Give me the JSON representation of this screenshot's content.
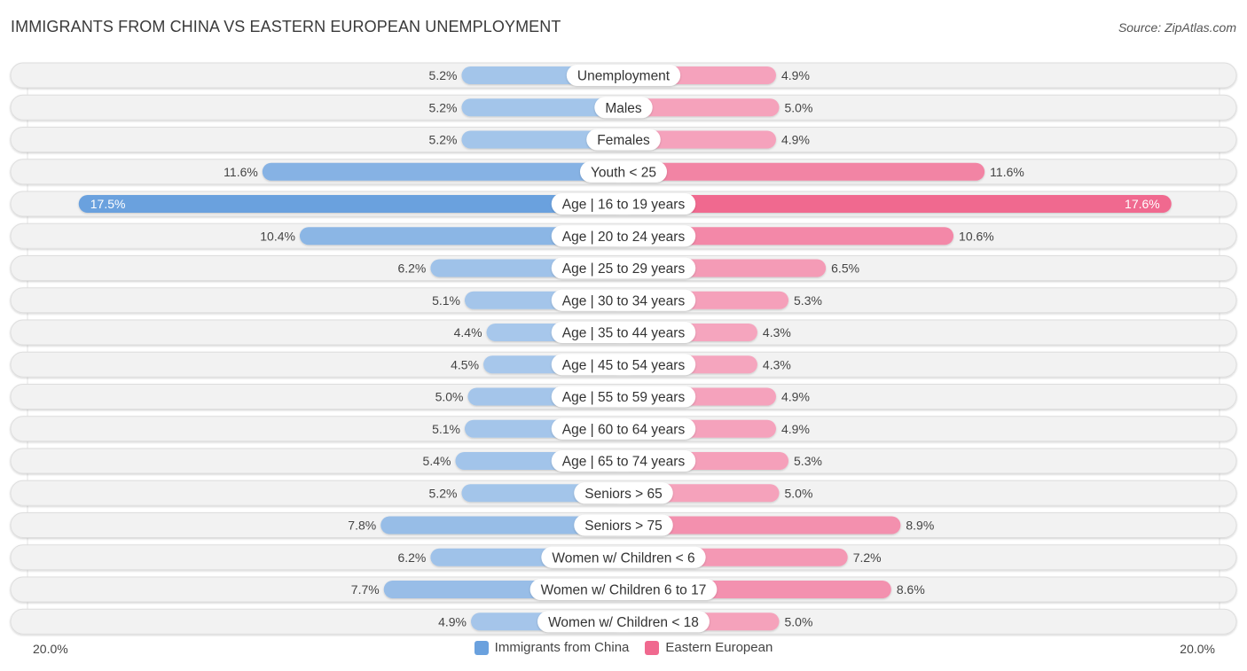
{
  "header": {
    "title": "IMMIGRANTS FROM CHINA VS EASTERN EUROPEAN UNEMPLOYMENT",
    "source": "Source: ZipAtlas.com"
  },
  "colors": {
    "china": "#6aa1de",
    "china_light": "#a9c8eb",
    "eastern": "#f0698f",
    "eastern_light": "#f5a6bf",
    "track": "#f2f2f2"
  },
  "chart_data": {
    "type": "bar",
    "orientation": "horizontal-diverging",
    "title": "IMMIGRANTS FROM CHINA VS EASTERN EUROPEAN UNEMPLOYMENT",
    "xlim": [
      -20.0,
      20.0
    ],
    "axis_labels": {
      "left": "20.0%",
      "right": "20.0%"
    },
    "legend_position": "bottom-center",
    "categories": [
      "Unemployment",
      "Males",
      "Females",
      "Youth < 25",
      "Age | 16 to 19 years",
      "Age | 20 to 24 years",
      "Age | 25 to 29 years",
      "Age | 30 to 34 years",
      "Age | 35 to 44 years",
      "Age | 45 to 54 years",
      "Age | 55 to 59 years",
      "Age | 60 to 64 years",
      "Age | 65 to 74 years",
      "Seniors > 65",
      "Seniors > 75",
      "Women w/ Children < 6",
      "Women w/ Children 6 to 17",
      "Women w/ Children < 18"
    ],
    "series": [
      {
        "name": "Immigrants from China",
        "side": "left",
        "values": [
          5.2,
          5.2,
          5.2,
          11.6,
          17.5,
          10.4,
          6.2,
          5.1,
          4.4,
          4.5,
          5.0,
          5.1,
          5.4,
          5.2,
          7.8,
          6.2,
          7.7,
          4.9
        ],
        "labels": [
          "5.2%",
          "5.2%",
          "5.2%",
          "11.6%",
          "17.5%",
          "10.4%",
          "6.2%",
          "5.1%",
          "4.4%",
          "4.5%",
          "5.0%",
          "5.1%",
          "5.4%",
          "5.2%",
          "7.8%",
          "6.2%",
          "7.7%",
          "4.9%"
        ]
      },
      {
        "name": "Eastern European",
        "side": "right",
        "values": [
          4.9,
          5.0,
          4.9,
          11.6,
          17.6,
          10.6,
          6.5,
          5.3,
          4.3,
          4.3,
          4.9,
          4.9,
          5.3,
          5.0,
          8.9,
          7.2,
          8.6,
          5.0
        ],
        "labels": [
          "4.9%",
          "5.0%",
          "4.9%",
          "11.6%",
          "17.6%",
          "10.6%",
          "6.5%",
          "5.3%",
          "4.3%",
          "4.3%",
          "4.9%",
          "4.9%",
          "5.3%",
          "5.0%",
          "8.9%",
          "7.2%",
          "8.6%",
          "5.0%"
        ]
      }
    ]
  },
  "legend": {
    "items": [
      {
        "label": "Immigrants from China"
      },
      {
        "label": "Eastern European"
      }
    ]
  }
}
